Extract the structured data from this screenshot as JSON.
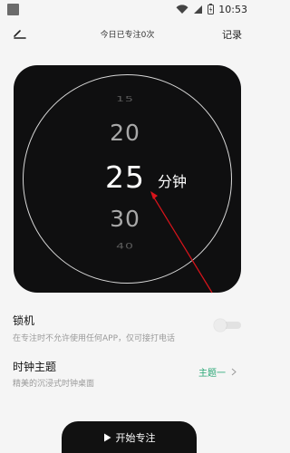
{
  "status_bar": {
    "time": "10:53"
  },
  "header": {
    "title": "今日已专注0次",
    "record_label": "记录"
  },
  "clock": {
    "picker_values": [
      "15",
      "20",
      "25",
      "30",
      "40"
    ],
    "selected_value": "25",
    "unit": "分钟"
  },
  "settings": {
    "lock": {
      "title": "锁机",
      "description": "在专注时不允许使用任何APP，仅可接打电话",
      "enabled": false
    },
    "theme": {
      "title": "时钟主题",
      "description": "精美的沉浸式时钟桌面",
      "value": "主题一"
    }
  },
  "start_button": {
    "label": "开始专注"
  },
  "colors": {
    "accent": "#2aa876",
    "card": "#0f0f10",
    "arrow": "#d9141b"
  }
}
